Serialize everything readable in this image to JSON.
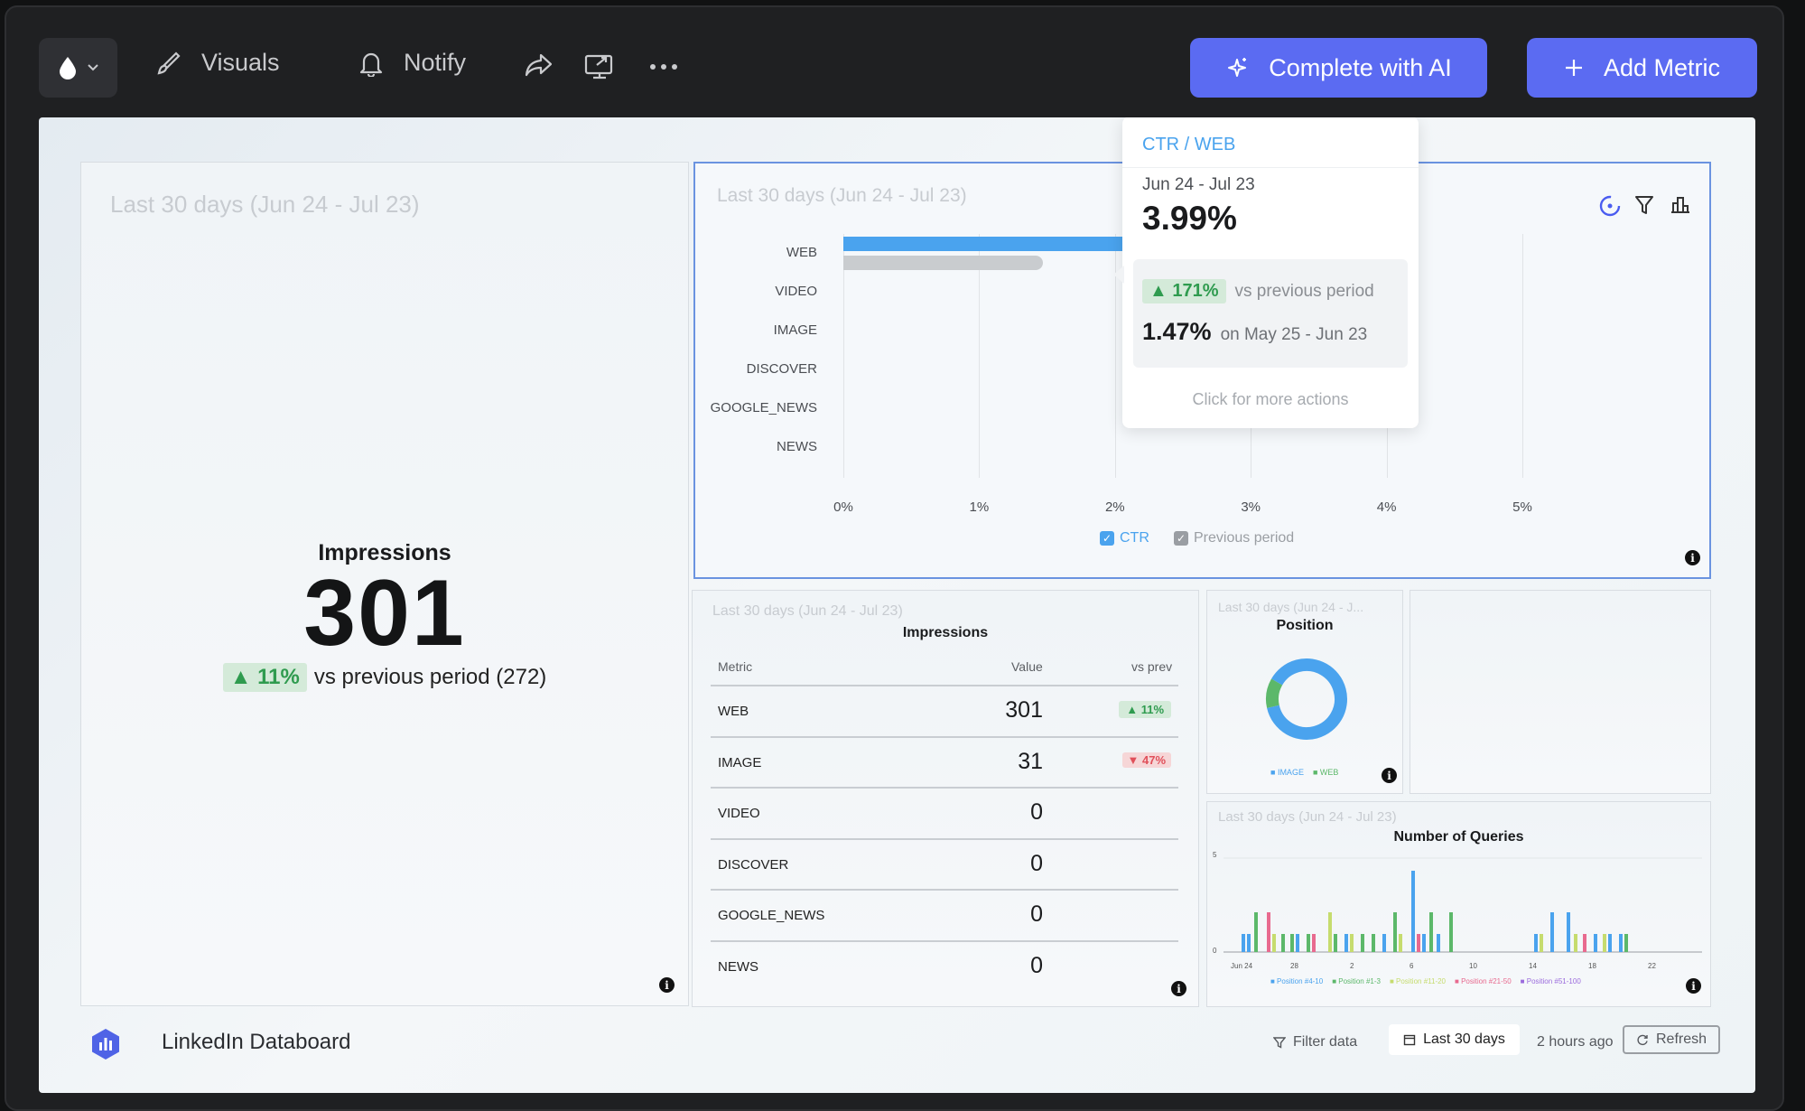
{
  "toolbar": {
    "visuals_label": "Visuals",
    "notify_label": "Notify",
    "complete_ai_label": "Complete with AI",
    "add_metric_label": "Add Metric"
  },
  "impressions_card": {
    "date_range": "Last 30 days (Jun 24 - Jul 23)",
    "title": "Impressions",
    "value": "301",
    "change": "▲ 11%",
    "comparison": "vs previous period (272)"
  },
  "ctr_card": {
    "date_range": "Last 30 days (Jun 24 - Jul 23)",
    "legend_current": "CTR",
    "legend_previous": "Previous period"
  },
  "chart_data": {
    "type": "bar",
    "orientation": "horizontal",
    "categories": [
      "WEB",
      "VIDEO",
      "IMAGE",
      "DISCOVER",
      "GOOGLE_NEWS",
      "NEWS"
    ],
    "series": [
      {
        "name": "CTR",
        "values": [
          3.99,
          0,
          0,
          0,
          0,
          0
        ],
        "color": "#4aa3ee"
      },
      {
        "name": "Previous period",
        "values": [
          1.47,
          0,
          0,
          0,
          0,
          0
        ],
        "color": "#c9cccf"
      }
    ],
    "xticks": [
      "0%",
      "1%",
      "2%",
      "3%",
      "4%",
      "5%"
    ],
    "xlim": [
      0,
      5
    ],
    "grid": true,
    "legend": "bottom"
  },
  "tooltip": {
    "header": "CTR / WEB",
    "date": "Jun 24 - Jul 23",
    "value": "3.99%",
    "change": "▲ 171%",
    "vs_label": "vs previous period",
    "prev_value": "1.47%",
    "prev_range": "on May 25 - Jun 23",
    "more": "Click for more actions"
  },
  "table_card": {
    "date_range": "Last 30 days (Jun 24 - Jul 23)",
    "title": "Impressions",
    "headers": [
      "Metric",
      "Value",
      "vs prev"
    ],
    "rows": [
      {
        "metric": "WEB",
        "value": "301",
        "change": "▲ 11%",
        "dir": "up"
      },
      {
        "metric": "IMAGE",
        "value": "31",
        "change": "▼ 47%",
        "dir": "down"
      },
      {
        "metric": "VIDEO",
        "value": "0",
        "change": "",
        "dir": ""
      },
      {
        "metric": "DISCOVER",
        "value": "0",
        "change": "",
        "dir": ""
      },
      {
        "metric": "GOOGLE_NEWS",
        "value": "0",
        "change": "",
        "dir": ""
      },
      {
        "metric": "NEWS",
        "value": "0",
        "change": "",
        "dir": ""
      }
    ]
  },
  "position_card": {
    "date_range": "Last 30 days (Jun 24 - J...",
    "title": "Position",
    "legend": [
      "IMAGE",
      "WEB"
    ],
    "colors": [
      "#4aa3ee",
      "#5cb86a"
    ],
    "values": [
      88,
      12
    ]
  },
  "queries_card": {
    "date_range": "Last 30 days (Jun 24 - Jul 23)",
    "title": "Number of Queries",
    "yticks": [
      "5",
      "0"
    ],
    "xticks": [
      "Jun 24",
      "28",
      "2",
      "6",
      "10",
      "14",
      "18",
      "22"
    ],
    "legend": [
      {
        "name": "Position #4-10",
        "color": "#4aa3ee"
      },
      {
        "name": "Position #1-3",
        "color": "#5cb86a"
      },
      {
        "name": "Position #11-20",
        "color": "#c6dc6e"
      },
      {
        "name": "Position #21-50",
        "color": "#e86a8f"
      },
      {
        "name": "Position #51-100",
        "color": "#9b6bdd"
      }
    ]
  },
  "footer": {
    "name": "LinkedIn Databoard",
    "filter": "Filter data",
    "range": "Last 30 days",
    "updated": "2 hours ago",
    "refresh": "Refresh"
  }
}
